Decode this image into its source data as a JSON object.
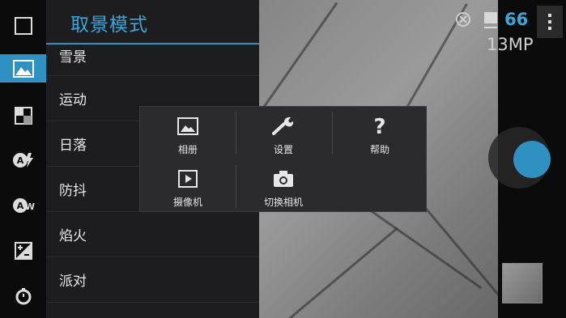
{
  "scene_panel": {
    "title": "取景模式",
    "items": [
      "雪景",
      "运动",
      "日落",
      "防抖",
      "焰火",
      "派对"
    ]
  },
  "status": {
    "shots_remaining": "66",
    "resolution": "13MP"
  },
  "popup_menu": {
    "items": [
      {
        "label": "相册",
        "icon": "gallery-icon"
      },
      {
        "label": "设置",
        "icon": "wrench-icon"
      },
      {
        "label": "帮助",
        "icon": "help-icon"
      },
      {
        "label": "摄像机",
        "icon": "video-play-icon"
      },
      {
        "label": "切换相机",
        "icon": "camera-switch-icon"
      }
    ]
  },
  "rail": {
    "icons": [
      "square-icon",
      "landscape-scene-icon",
      "exposure-bracket-icon",
      "auto-flash-icon",
      "auto-white-balance-icon",
      "exposure-compensation-icon",
      "timer-icon"
    ],
    "active": "landscape-scene-icon"
  },
  "colors": {
    "accent": "#2f90c2",
    "panel_bg": "#1d1d1f",
    "popup_bg": "#2b2b2d"
  }
}
